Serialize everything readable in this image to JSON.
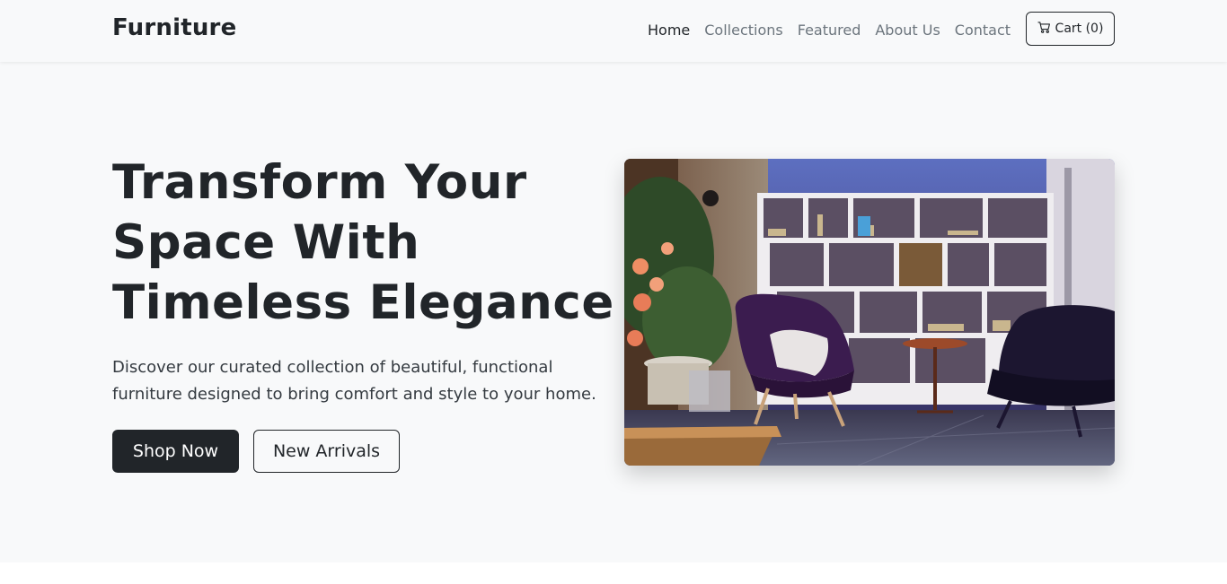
{
  "navbar": {
    "brand": "Furniture",
    "links": [
      {
        "label": "Home",
        "active": true
      },
      {
        "label": "Collections",
        "active": false
      },
      {
        "label": "Featured",
        "active": false
      },
      {
        "label": "About Us",
        "active": false
      },
      {
        "label": "Contact",
        "active": false
      }
    ],
    "cart_label": "Cart (0)",
    "cart_icon": "cart-icon"
  },
  "hero": {
    "title": "Transform Your Space With Timeless Elegance",
    "description": "Discover our curated collection of beautiful, functional furniture designed to bring comfort and style to your home.",
    "primary_button": "Shop Now",
    "secondary_button": "New Arrivals",
    "image_subject": "interior-living-room-photo"
  },
  "colors": {
    "primary_dark": "#212529",
    "background": "#f8f9fa",
    "muted_text": "#6c757d"
  }
}
